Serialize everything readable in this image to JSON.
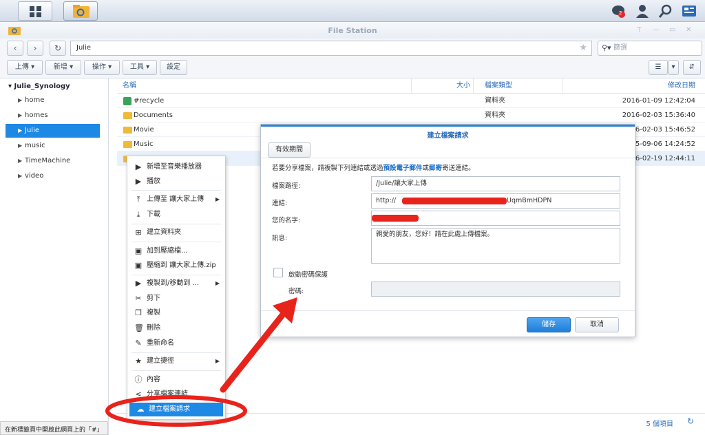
{
  "app": {
    "title": "File Station"
  },
  "taskbar": {
    "notification_count": "2"
  },
  "nav": {
    "path": "Julie",
    "search_placeholder": "篩選"
  },
  "toolbar": {
    "upload": "上傳 ▾",
    "create": "新增 ▾",
    "action": "操作 ▾",
    "tools": "工具 ▾",
    "settings": "設定"
  },
  "sidebar": {
    "root": "Julie_Synology",
    "items": [
      {
        "label": "home"
      },
      {
        "label": "homes"
      },
      {
        "label": "Julie"
      },
      {
        "label": "music"
      },
      {
        "label": "TimeMachine"
      },
      {
        "label": "video"
      }
    ]
  },
  "list": {
    "headers": {
      "name": "名稱",
      "size": "大小",
      "type": "檔案類型",
      "modified": "修改日期"
    },
    "rows": [
      {
        "name": "#recycle",
        "type": "資料夾",
        "date": "2016-01-09 12:42:04"
      },
      {
        "name": "Documents",
        "type": "資料夾",
        "date": "2016-02-03 15:36:40"
      },
      {
        "name": "Movie",
        "type": "",
        "date": "6-02-03 15:46:52"
      },
      {
        "name": "Music",
        "type": "",
        "date": "5-09-06 14:24:52"
      },
      {
        "name": "",
        "type": "",
        "date": "6-02-19 12:44:11"
      }
    ]
  },
  "status": {
    "count": "5 個項目",
    "url_hint": "在新標籤頁中開啟此網頁上的「#」"
  },
  "context_menu": {
    "items": [
      "新增至音樂播放器",
      "播放",
      "上傳至 讓大家上傳",
      "下載",
      "建立資料夾",
      "加到壓縮檔...",
      "壓縮到 讓大家上傳.zip",
      "複製到/移動到 ...",
      "剪下",
      "複製",
      "刪除",
      "重新命名",
      "建立捷徑",
      "內容",
      "分享檔案連結",
      "建立檔案請求"
    ]
  },
  "dialog": {
    "title": "建立檔案請求",
    "tab": "有效期間",
    "note_pre": "若要分享檔案，請複製下列連結或透過",
    "note_link1": "預設電子郵件",
    "note_mid": "或",
    "note_link2": "郵寄",
    "note_post": "寄送連結。",
    "path_label": "檔案路徑:",
    "path_value": "/Julie/讓大家上傳",
    "link_label": "連結:",
    "link_prefix": "http://",
    "link_suffix": "UqmBmHDPN",
    "name_label": "您的名字:",
    "message_label": "訊息:",
    "message_value": "親愛的朋友，您好！請在此處上傳檔案。",
    "password_toggle": "啟動密碼保護",
    "password_label": "密碼:",
    "save": "儲存",
    "cancel": "取消"
  }
}
